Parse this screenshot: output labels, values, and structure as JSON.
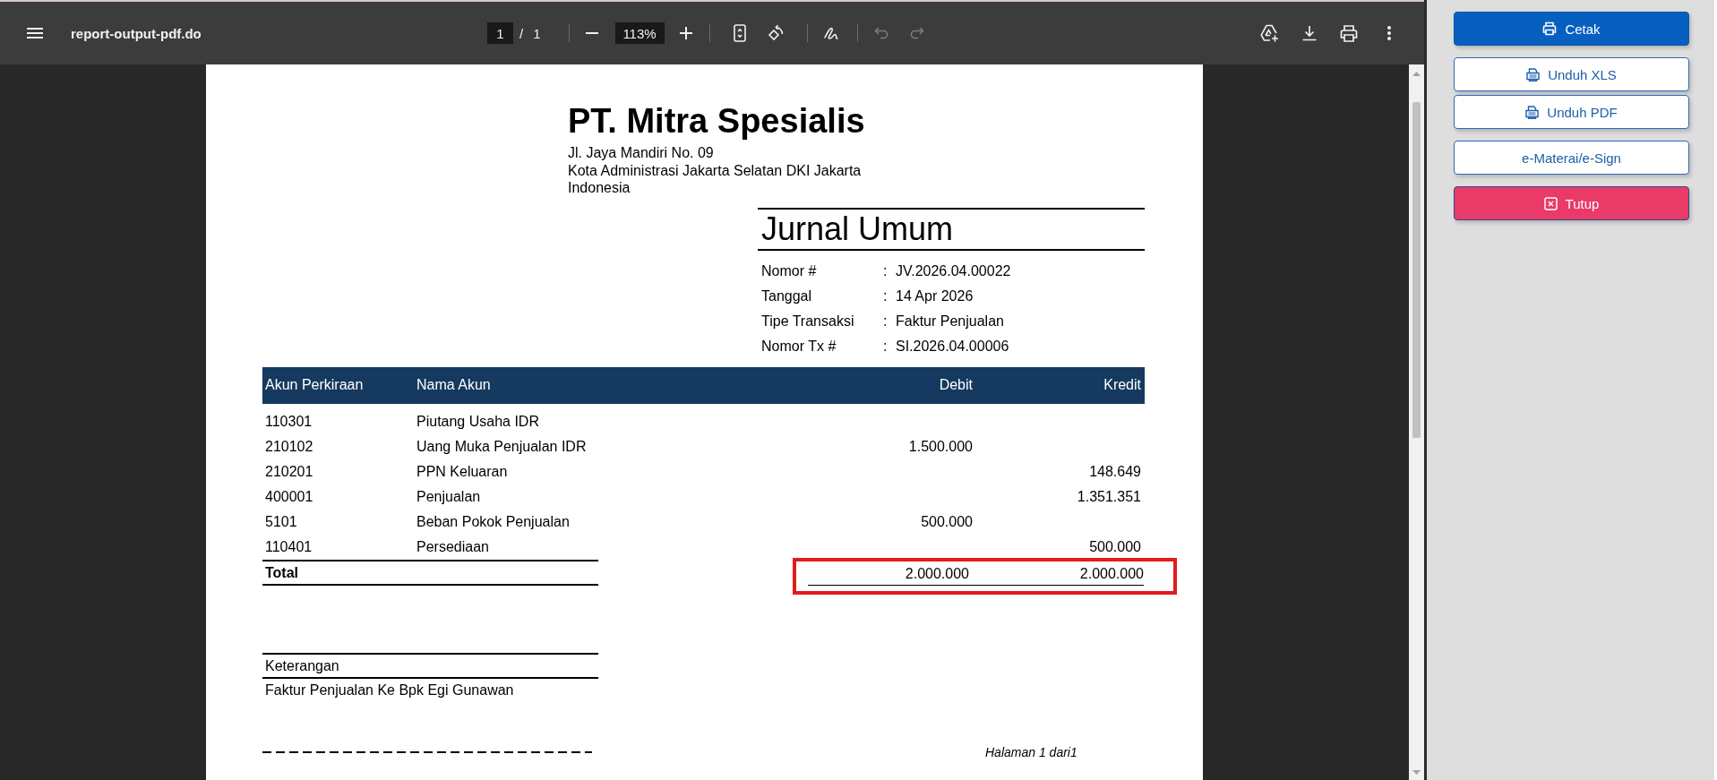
{
  "toolbar": {
    "title": "report-output-pdf.do",
    "page": {
      "current": "1",
      "separator": "/",
      "total": "1"
    },
    "zoom": "113%",
    "undo": {
      "disabled": true
    },
    "redo": {
      "disabled": true
    }
  },
  "document": {
    "company": {
      "name": "PT. Mitra Spesialis",
      "address": [
        "Jl. Jaya Mandiri No. 09",
        "Kota Administrasi Jakarta Selatan DKI Jakarta",
        "Indonesia"
      ]
    },
    "title": "Jurnal Umum",
    "info": [
      {
        "label": "Nomor #",
        "separator": ":",
        "value": "JV.2026.04.00022"
      },
      {
        "label": "Tanggal",
        "separator": ":",
        "value": "14 Apr 2026"
      },
      {
        "label": "Tipe Transaksi",
        "separator": ":",
        "value": "Faktur Penjualan"
      },
      {
        "label": "Nomor Tx #",
        "separator": ":",
        "value": "SI.2026.04.00006"
      }
    ],
    "table": {
      "columns": [
        "Akun Perkiraan",
        "Nama Akun",
        "Debit",
        "Kredit"
      ],
      "rows": [
        {
          "account": "110301",
          "name": "Piutang Usaha IDR"
        },
        {
          "account": "210102",
          "name": "Uang Muka Penjualan IDR",
          "debit": "1.500.000"
        },
        {
          "account": "210201",
          "name": "PPN Keluaran",
          "credit": "148.649"
        },
        {
          "account": "400001",
          "name": "Penjualan",
          "credit": "1.351.351"
        },
        {
          "account": "5101",
          "name": "Beban Pokok Penjualan",
          "debit": "500.000"
        },
        {
          "account": "110401",
          "name": "Persediaan",
          "credit": "500.000"
        }
      ],
      "total": {
        "label": "Total",
        "debit": "2.000.000",
        "credit": "2.000.000",
        "highlighted": true
      }
    },
    "notes": {
      "label": "Keterangan",
      "text": "Faktur Penjualan Ke Bpk Egi Gunawan"
    },
    "footer": "Halaman 1 dari1"
  },
  "side_panel": {
    "button_groups": [
      [
        {
          "label": "Cetak",
          "kind": "print"
        }
      ],
      [
        {
          "label": "Unduh XLS",
          "kind": "xls"
        },
        {
          "label": "Unduh PDF",
          "kind": "pdf"
        }
      ],
      [
        {
          "label": "e-Materai/e-Sign",
          "kind": "esign"
        }
      ],
      [
        {
          "label": "Tutup",
          "kind": "close"
        }
      ]
    ]
  }
}
